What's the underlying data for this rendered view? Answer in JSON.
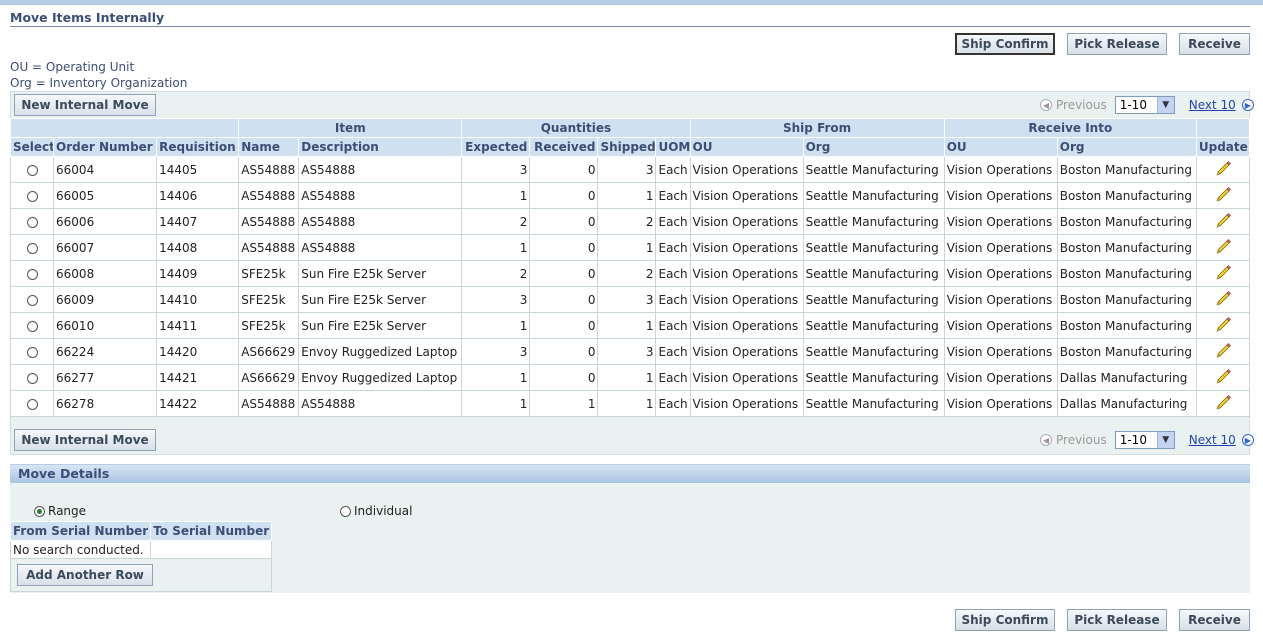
{
  "page": {
    "title": "Move Items Internally",
    "legend": [
      "OU = Operating Unit",
      "Org = Inventory Organization"
    ]
  },
  "actions": {
    "ship_confirm": "Ship Confirm",
    "pick_release": "Pick Release",
    "receive": "Receive"
  },
  "results": {
    "new_internal_move": "New Internal Move",
    "nav": {
      "previous": "Previous",
      "range": "1-10",
      "next": "Next 10"
    },
    "group_headers": {
      "item": "Item",
      "quantities": "Quantities",
      "ship_from": "Ship From",
      "receive_into": "Receive Into"
    },
    "columns": [
      "Select",
      "Order Number",
      "Requisition",
      "Name",
      "Description",
      "Expected",
      "Received",
      "Shipped",
      "UOM",
      "OU",
      "Org",
      "OU",
      "Org",
      "Update"
    ],
    "rows": [
      {
        "order": "66004",
        "req": "14405",
        "name": "AS54888",
        "desc": "AS54888",
        "exp": "3",
        "rec": "0",
        "shp": "3",
        "uom": "Each",
        "sou": "Vision Operations",
        "sorg": "Seattle Manufacturing",
        "rou": "Vision Operations",
        "rorg": "Boston Manufacturing"
      },
      {
        "order": "66005",
        "req": "14406",
        "name": "AS54888",
        "desc": "AS54888",
        "exp": "1",
        "rec": "0",
        "shp": "1",
        "uom": "Each",
        "sou": "Vision Operations",
        "sorg": "Seattle Manufacturing",
        "rou": "Vision Operations",
        "rorg": "Boston Manufacturing"
      },
      {
        "order": "66006",
        "req": "14407",
        "name": "AS54888",
        "desc": "AS54888",
        "exp": "2",
        "rec": "0",
        "shp": "2",
        "uom": "Each",
        "sou": "Vision Operations",
        "sorg": "Seattle Manufacturing",
        "rou": "Vision Operations",
        "rorg": "Boston Manufacturing"
      },
      {
        "order": "66007",
        "req": "14408",
        "name": "AS54888",
        "desc": "AS54888",
        "exp": "1",
        "rec": "0",
        "shp": "1",
        "uom": "Each",
        "sou": "Vision Operations",
        "sorg": "Seattle Manufacturing",
        "rou": "Vision Operations",
        "rorg": "Boston Manufacturing"
      },
      {
        "order": "66008",
        "req": "14409",
        "name": "SFE25k",
        "desc": "Sun Fire E25k Server",
        "exp": "2",
        "rec": "0",
        "shp": "2",
        "uom": "Each",
        "sou": "Vision Operations",
        "sorg": "Seattle Manufacturing",
        "rou": "Vision Operations",
        "rorg": "Boston Manufacturing"
      },
      {
        "order": "66009",
        "req": "14410",
        "name": "SFE25k",
        "desc": "Sun Fire E25k Server",
        "exp": "3",
        "rec": "0",
        "shp": "3",
        "uom": "Each",
        "sou": "Vision Operations",
        "sorg": "Seattle Manufacturing",
        "rou": "Vision Operations",
        "rorg": "Boston Manufacturing"
      },
      {
        "order": "66010",
        "req": "14411",
        "name": "SFE25k",
        "desc": "Sun Fire E25k Server",
        "exp": "1",
        "rec": "0",
        "shp": "1",
        "uom": "Each",
        "sou": "Vision Operations",
        "sorg": "Seattle Manufacturing",
        "rou": "Vision Operations",
        "rorg": "Boston Manufacturing"
      },
      {
        "order": "66224",
        "req": "14420",
        "name": "AS66629",
        "desc": "Envoy Ruggedized Laptop",
        "exp": "3",
        "rec": "0",
        "shp": "3",
        "uom": "Each",
        "sou": "Vision Operations",
        "sorg": "Seattle Manufacturing",
        "rou": "Vision Operations",
        "rorg": "Boston Manufacturing"
      },
      {
        "order": "66277",
        "req": "14421",
        "name": "AS66629",
        "desc": "Envoy Ruggedized Laptop",
        "exp": "1",
        "rec": "0",
        "shp": "1",
        "uom": "Each",
        "sou": "Vision Operations",
        "sorg": "Seattle Manufacturing",
        "rou": "Vision Operations",
        "rorg": "Dallas Manufacturing"
      },
      {
        "order": "66278",
        "req": "14422",
        "name": "AS54888",
        "desc": "AS54888",
        "exp": "1",
        "rec": "1",
        "shp": "1",
        "uom": "Each",
        "sou": "Vision Operations",
        "sorg": "Seattle Manufacturing",
        "rou": "Vision Operations",
        "rorg": "Dallas Manufacturing"
      }
    ]
  },
  "move_details": {
    "title": "Move Details",
    "range_label": "Range",
    "individual_label": "Individual",
    "selected": "Range",
    "serial_columns": [
      "From Serial Number",
      "To Serial Number"
    ],
    "empty_text": "No search conducted.",
    "add_row": "Add Another Row"
  },
  "colors": {
    "header_bg": "#cfe0f1",
    "panel_bg": "#eaf2f1",
    "title_color": "#3c4e75",
    "link": "#2244aa"
  },
  "icons": {
    "update": "pencil-icon",
    "prev": "previous-arrow-icon",
    "next": "next-arrow-icon"
  }
}
